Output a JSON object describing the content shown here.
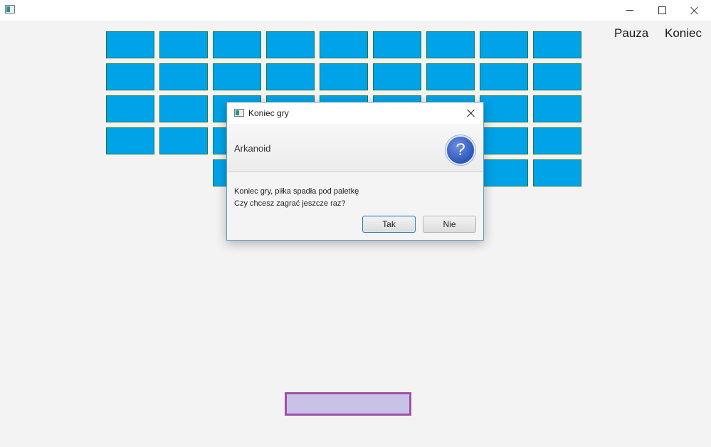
{
  "window": {
    "title": "",
    "controls": [
      "minimize",
      "maximize",
      "close"
    ]
  },
  "menu": {
    "pause_label": "Pauza",
    "end_label": "Koniec"
  },
  "game": {
    "brick_color": "#00a2e8",
    "brick_border_color": "#1f7a3a",
    "paddle_fill": "#c9c2e8",
    "paddle_border": "#a24fa8"
  },
  "dialog": {
    "title": "Koniec gry",
    "header": "Arkanoid",
    "message_line1": "Koniec gry, piłka spadła pod paletkę",
    "message_line2": "Czy chcesz zagrać jeszcze raz?",
    "yes_label": "Tak",
    "no_label": "Nie",
    "icon": "question-icon"
  }
}
